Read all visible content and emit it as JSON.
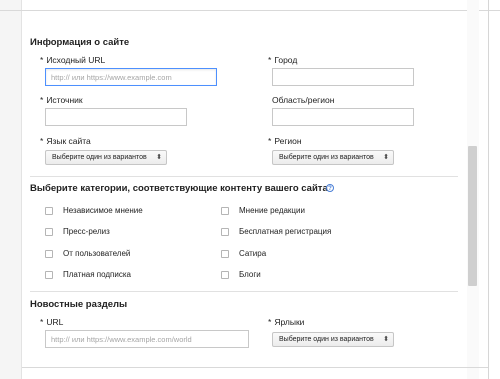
{
  "site_info": {
    "title": "Информация о сайте",
    "source_url": {
      "label": "Исходный URL",
      "placeholder": "http:// или https://www.example.com",
      "value": ""
    },
    "city": {
      "label": "Город",
      "value": ""
    },
    "source": {
      "label": "Источник",
      "value": ""
    },
    "region_area": {
      "label": "Область/регион",
      "value": ""
    },
    "site_language": {
      "label": "Язык сайта",
      "selected": "Выберите один из вариантов"
    },
    "region": {
      "label": "Регион",
      "selected": "Выберите один из вариантов"
    },
    "required_mark": "*"
  },
  "categories": {
    "title": "Выберите категории, соответствующие контенту вашего сайта",
    "help_icon": "?",
    "left": [
      "Независимое мнение",
      "Пресс-релиз",
      "От пользователей",
      "Платная подписка"
    ],
    "right": [
      "Мнение редакции",
      "Бесплатная регистрация",
      "Сатира",
      "Блоги"
    ]
  },
  "news_sections": {
    "title": "Новостные разделы",
    "url": {
      "label": "URL",
      "placeholder": "http:// или https://www.example.com/world",
      "value": ""
    },
    "tags": {
      "label": "Ярлыки",
      "selected": "Выберите один из вариантов"
    }
  },
  "select_arrows": "⬍"
}
